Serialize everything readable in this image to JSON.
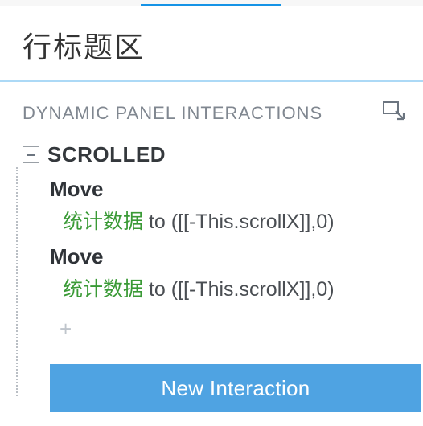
{
  "header": {
    "title": "行标题区"
  },
  "panel": {
    "section_label": "DYNAMIC PANEL INTERACTIONS",
    "event_name": "SCROLLED",
    "actions": [
      {
        "label": "Move",
        "target": "统计数据",
        "expr": " to ([[-This.scrollX]],0)"
      },
      {
        "label": "Move",
        "target": "统计数据",
        "expr": " to ([[-This.scrollX]],0)"
      }
    ],
    "add_label": "+",
    "new_interaction_label": "New Interaction"
  }
}
